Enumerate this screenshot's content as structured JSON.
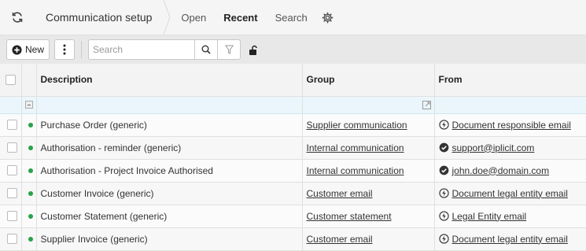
{
  "header": {
    "title": "Communication setup",
    "tabs": [
      {
        "label": "Open",
        "active": false
      },
      {
        "label": "Recent",
        "active": true
      },
      {
        "label": "Search",
        "active": false
      }
    ]
  },
  "toolbar": {
    "new_label": "New",
    "search_placeholder": "Search"
  },
  "table": {
    "columns": [
      "Description",
      "Group",
      "From"
    ],
    "rows": [
      {
        "description": "Purchase Order (generic)",
        "group": "Supplier communication",
        "from": "Document responsible email",
        "from_icon": "lightning-icon",
        "active": true
      },
      {
        "description": "Authorisation - reminder (generic)",
        "group": "Internal communication",
        "from": "support@iplicit.com",
        "from_icon": "check-circle-icon",
        "active": true
      },
      {
        "description": "Authorisation - Project Invoice Authorised",
        "group": "Internal communication",
        "from": "john.doe@domain.com",
        "from_icon": "check-circle-icon",
        "active": true
      },
      {
        "description": "Customer Invoice (generic)",
        "group": "Customer email",
        "from": "Document legal entity email",
        "from_icon": "lightning-icon",
        "active": true
      },
      {
        "description": "Customer Statement (generic)",
        "group": "Customer statement",
        "from": "Legal Entity email",
        "from_icon": "lightning-icon",
        "active": true
      },
      {
        "description": "Supplier Invoice (generic)",
        "group": "Customer email",
        "from": "Document legal entity email",
        "from_icon": "lightning-icon",
        "active": true
      }
    ]
  },
  "colors": {
    "status_active": "#2aa14a",
    "filter_row_bg": "#eaf6fb"
  }
}
